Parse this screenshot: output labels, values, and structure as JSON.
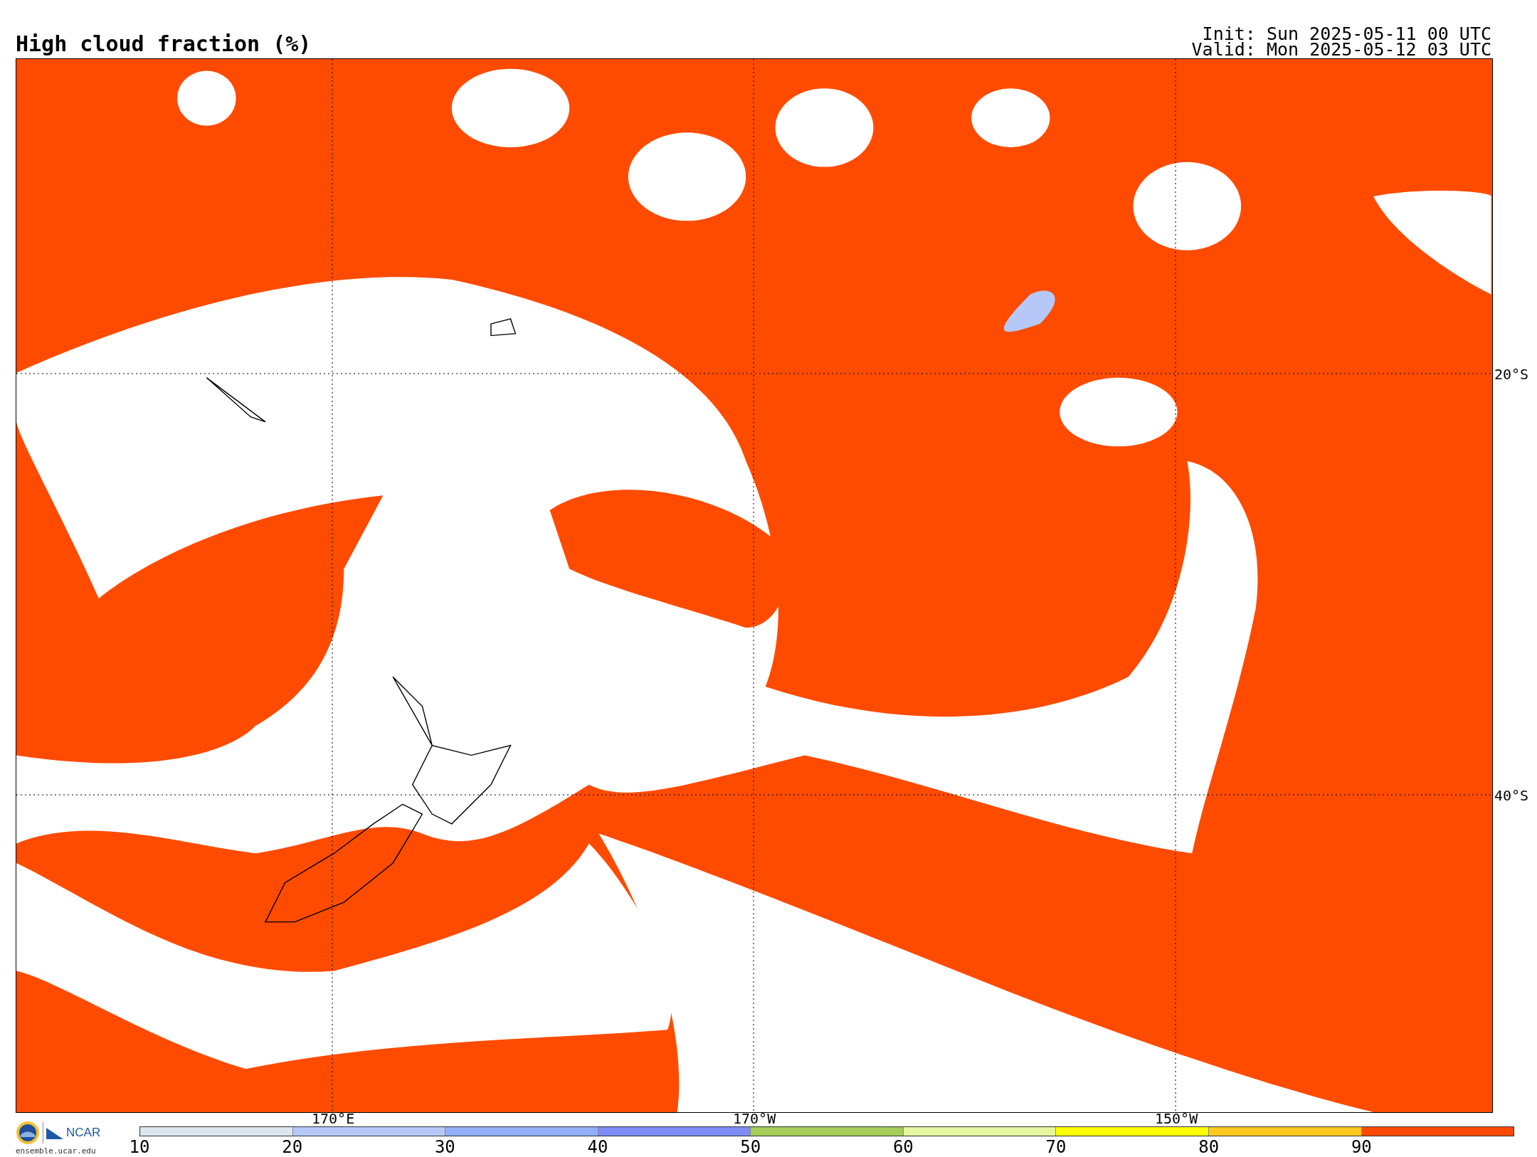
{
  "title": "High cloud fraction (%)",
  "run_info": [
    "Init: Sun 2025-05-11 00 UTC",
    "Valid: Mon 2025-05-12 03 UTC"
  ],
  "map": {
    "lat_labels": [
      "20°S",
      "40°S"
    ],
    "lon_labels": [
      "170°E",
      "170°W",
      "150°W"
    ]
  },
  "logo": {
    "name": "NCAR",
    "site": "ensemble.ucar.edu"
  },
  "colorbar": {
    "bins": [
      {
        "color": "#dbe6f0"
      },
      {
        "color": "#b5c8f7"
      },
      {
        "color": "#92b0f7"
      },
      {
        "color": "#7d8cf7"
      },
      {
        "color": "#a5cd5a"
      },
      {
        "color": "#e6f5a0"
      },
      {
        "color": "#ffff00"
      },
      {
        "color": "#ffc820"
      },
      {
        "color": "#ff4b00"
      }
    ],
    "ticks": [
      "10",
      "20",
      "30",
      "40",
      "50",
      "60",
      "70",
      "80",
      "90"
    ]
  }
}
